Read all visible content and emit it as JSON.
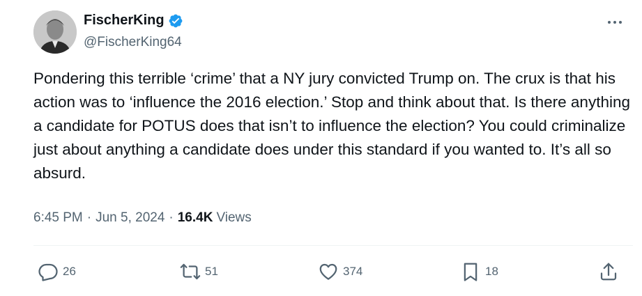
{
  "author": {
    "display_name": "FischerKing",
    "handle": "@FischerKing64",
    "verified": true
  },
  "tweet": {
    "text": "Pondering this terrible ‘crime’ that a NY jury convicted Trump on. The crux is that his action was to ‘influence the 2016 election.’ Stop and think about that. Is there anything a candidate for POTUS does that isn’t to influence the election? You could criminalize just about anything a candidate does under this standard if you wanted to. It’s all so absurd.",
    "time": "6:45 PM",
    "date": "Jun 5, 2024",
    "separator": "·",
    "views_count": "16.4K",
    "views_label": "Views"
  },
  "actions": {
    "replies": "26",
    "reposts": "51",
    "likes": "374",
    "bookmarks": "18"
  },
  "icons": {
    "more": "more-horizontal-icon",
    "verified": "verified-badge-icon",
    "reply": "reply-icon",
    "repost": "repost-icon",
    "like": "heart-icon",
    "bookmark": "bookmark-icon",
    "share": "share-icon"
  },
  "colors": {
    "text": "#0f1419",
    "secondary": "#536471",
    "verified": "#1d9bf0",
    "divider": "#eff3f4"
  }
}
